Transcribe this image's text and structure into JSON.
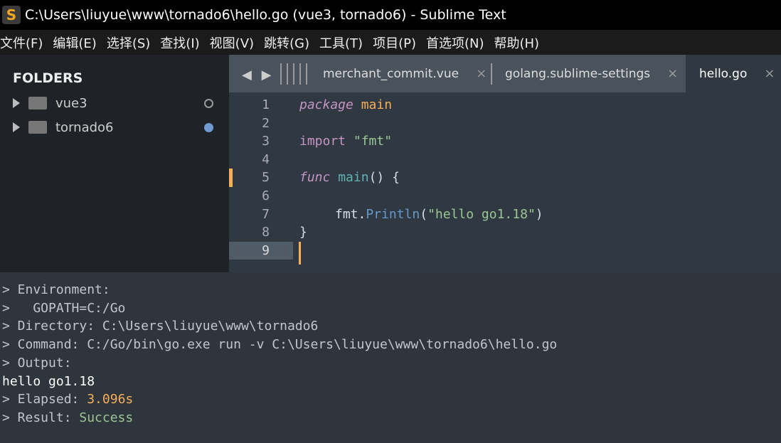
{
  "window": {
    "title": "C:\\Users\\liuyue\\www\\tornado6\\hello.go (vue3, tornado6) - Sublime Text",
    "logo": "S"
  },
  "menu": [
    "文件(F)",
    "编辑(E)",
    "选择(S)",
    "查找(I)",
    "视图(V)",
    "跳转(G)",
    "工具(T)",
    "项目(P)",
    "首选项(N)",
    "帮助(H)"
  ],
  "sidebar": {
    "heading": "FOLDERS",
    "folders": [
      {
        "name": "vue3",
        "status": "open"
      },
      {
        "name": "tornado6",
        "status": "modified"
      }
    ]
  },
  "tabs": [
    {
      "label": "merchant_commit.vue",
      "close": "×"
    },
    {
      "label": "golang.sublime-settings",
      "close": "×"
    },
    {
      "label": "hello.go",
      "close": "×",
      "active": true
    }
  ],
  "nav": "◀ ▶",
  "editor": {
    "line_numbers": [
      "1",
      "2",
      "3",
      "4",
      "5",
      "6",
      "7",
      "8",
      "9"
    ],
    "code": {
      "l1a": "package",
      "l1b": "main",
      "l3a": "import",
      "l3b": "\"fmt\"",
      "l5a": "func",
      "l5b": "main",
      "l5c": "() {",
      "l7a": "fmt.",
      "l7b": "Println",
      "l7c": "(",
      "l7d": "\"hello go1.18\"",
      "l7e": ")",
      "l8": "}"
    }
  },
  "output": {
    "lines": [
      "> Environment:",
      ">   GOPATH=C:/Go",
      "> Directory: C:\\Users\\liuyue\\www\\tornado6",
      "> Command: C:/Go/bin\\go.exe run -v C:\\Users\\liuyue\\www\\tornado6\\hello.go",
      "> Output:",
      "hello go1.18"
    ],
    "elapsed_label": "> Elapsed: ",
    "elapsed_value": "3.096s",
    "result_label": "> Result: ",
    "result_value": "Success"
  },
  "colors": {
    "accent": "#f9ae58",
    "success": "#99c794",
    "modified_dot": "#6699cc"
  }
}
